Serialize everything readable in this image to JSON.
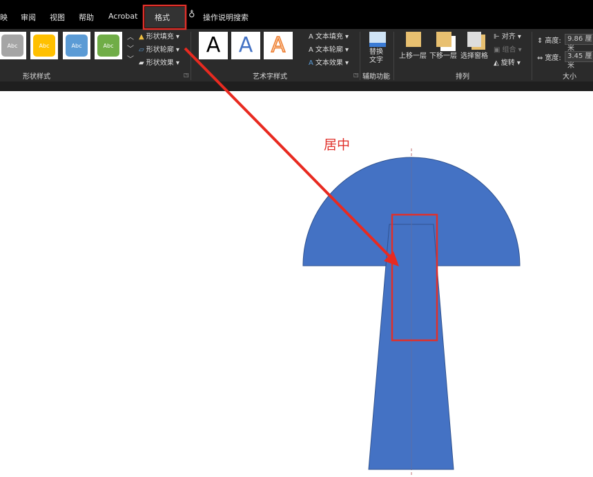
{
  "tabs": [
    "映",
    "审阅",
    "视图",
    "帮助",
    "Acrobat",
    "格式"
  ],
  "active_tab": "格式",
  "tell_me": "操作说明搜索",
  "shape_styles": {
    "swatches": [
      {
        "label": "Abc",
        "color": "#a5a5a5"
      },
      {
        "label": "Abc",
        "color": "#ffc000"
      },
      {
        "label": "Abc",
        "color": "#5b9bd5"
      },
      {
        "label": "Abc",
        "color": "#70ad47"
      }
    ],
    "fill": "形状填充",
    "outline": "形状轮廓",
    "effects": "形状效果",
    "group": "形状样式"
  },
  "wordart": {
    "letters": [
      "A",
      "A",
      "A"
    ],
    "text_fill": "文本填充",
    "text_outline": "文本轮廓",
    "text_effects": "文本效果",
    "group": "艺术字样式"
  },
  "accessibility": {
    "alt_text": "替换\n文字",
    "group": "辅助功能"
  },
  "arrange": {
    "bring_forward": "上移一层",
    "send_backward": "下移一层",
    "selection_pane": "选择窗格",
    "align": "对齐",
    "group_cmd": "组合",
    "rotate": "旋转",
    "group": "排列"
  },
  "size": {
    "height_label": "高度:",
    "height_value": "9.86 厘米",
    "width_label": "宽度:",
    "width_value": "3.45 厘米",
    "group": "大小"
  },
  "annotation": {
    "text": "居中",
    "color": "#e0302a"
  },
  "shape_color": "#4472c4"
}
